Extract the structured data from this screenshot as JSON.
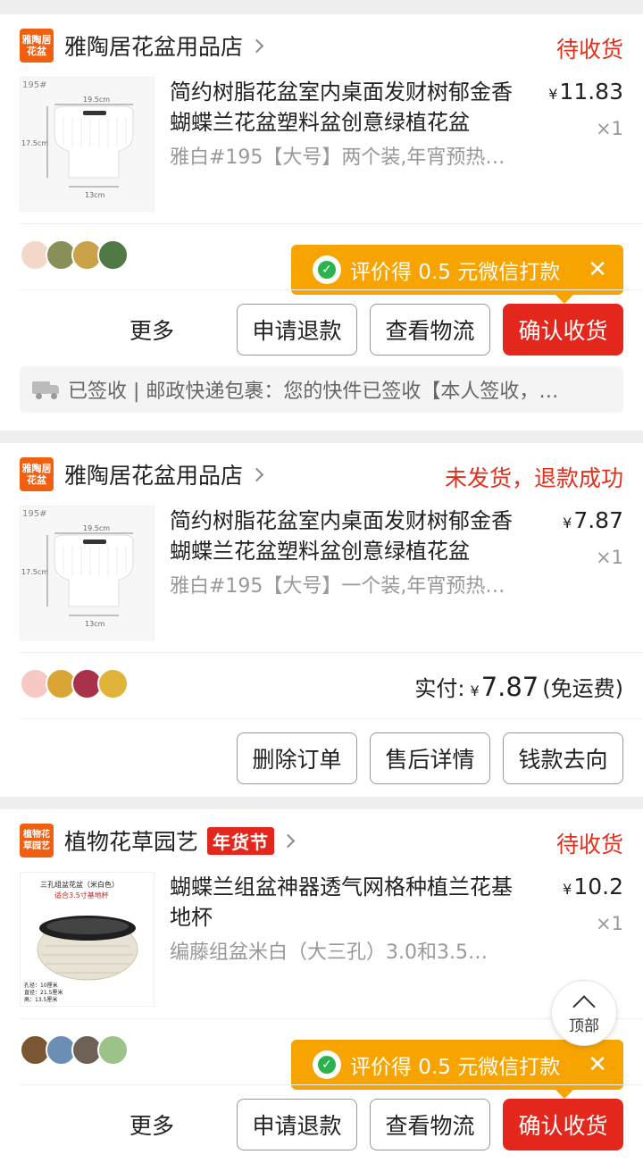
{
  "orders": [
    {
      "shop_logo_text": "雅陶居花盆",
      "shop_name": "雅陶居花盆用品店",
      "status": "待收货",
      "product_title": "简约树脂花盆室内桌面发财树郁金香蝴蝶兰花盆塑料盆创意绿植花盆",
      "variant": "雅白#195【大号】两个装,年宵预热…",
      "price": "11.83",
      "quantity": "×1",
      "thumb": {
        "code": "195#",
        "width_label": "19.5cm",
        "height_label": "17.5cm",
        "base_label": "13cm"
      },
      "tip": "评价得 0.5 元微信打款",
      "buttons": {
        "more": "更多",
        "refund": "申请退款",
        "logistics": "查看物流",
        "confirm": "确认收货"
      },
      "logistics_text": "已签收 | 邮政快递包裹：您的快件已签收【本人签收，…"
    },
    {
      "shop_logo_text": "雅陶居花盆",
      "shop_name": "雅陶居花盆用品店",
      "status": "未发货，退款成功",
      "product_title": "简约树脂花盆室内桌面发财树郁金香蝴蝶兰花盆塑料盆创意绿植花盆",
      "variant": "雅白#195【大号】一个装,年宵预热…",
      "price": "7.87",
      "quantity": "×1",
      "thumb": {
        "code": "195#",
        "width_label": "19.5cm",
        "height_label": "17.5cm",
        "base_label": "13cm"
      },
      "paid_label": "实付:",
      "paid_amount": "7.87",
      "paid_note": "(免运费)",
      "buttons": {
        "delete": "删除订单",
        "aftersale": "售后详情",
        "money": "钱款去向"
      }
    },
    {
      "shop_logo_text": "植物花草园艺",
      "shop_name": "植物花草园艺",
      "badge": "年货节",
      "status": "待收货",
      "product_title": "蝴蝶兰组盆神器透气网格种植兰花基地杯",
      "variant": "编藤组盆米白（大三孔）3.0和3.5…",
      "price": "10.2",
      "quantity": "×1",
      "thumb": {
        "line1": "三孔组盆花盆（米白色）",
        "line2": "适合3.5寸基地杯",
        "spec1": "孔径：10厘米",
        "spec2": "直径：21.5厘米",
        "spec3": "高：13.5厘米"
      },
      "tip": "评价得 0.5 元微信打款",
      "buttons": {
        "more": "更多",
        "refund": "申请退款",
        "logistics": "查看物流",
        "confirm": "确认收货"
      }
    }
  ],
  "back_to_top": "顶部",
  "colors": {
    "accent_red": "#e4271c",
    "tip_orange": "#f7a400",
    "wechat_green": "#2bb24c"
  }
}
